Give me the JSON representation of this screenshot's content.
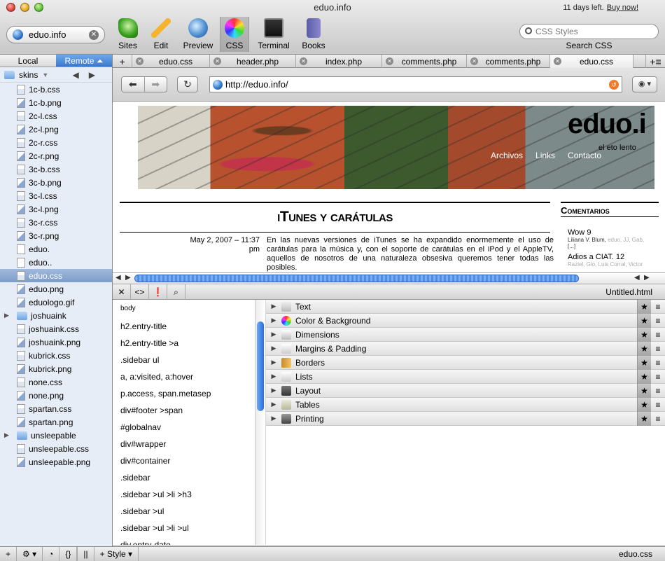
{
  "window": {
    "title": "eduo.info",
    "trial_text": "11 days left.",
    "buy_link": "Buy now!"
  },
  "site_selector": {
    "value": "eduo.info"
  },
  "toolbar": {
    "sites": "Sites",
    "edit": "Edit",
    "preview": "Preview",
    "css": "CSS",
    "terminal": "Terminal",
    "books": "Books",
    "search_placeholder": "CSS Styles",
    "search_label": "Search CSS"
  },
  "sidebar": {
    "local_tab": "Local",
    "remote_tab": "Remote",
    "current_folder": "skins",
    "files": [
      {
        "name": "1c-b.css",
        "kind": "css"
      },
      {
        "name": "1c-b.png",
        "kind": "img"
      },
      {
        "name": "2c-l.css",
        "kind": "css"
      },
      {
        "name": "2c-l.png",
        "kind": "img"
      },
      {
        "name": "2c-r.css",
        "kind": "css"
      },
      {
        "name": "2c-r.png",
        "kind": "img"
      },
      {
        "name": "3c-b.css",
        "kind": "css"
      },
      {
        "name": "3c-b.png",
        "kind": "img"
      },
      {
        "name": "3c-l.css",
        "kind": "css"
      },
      {
        "name": "3c-l.png",
        "kind": "img"
      },
      {
        "name": "3c-r.css",
        "kind": "css"
      },
      {
        "name": "3c-r.png",
        "kind": "img"
      },
      {
        "name": "eduo.",
        "kind": "plain"
      },
      {
        "name": "eduo..",
        "kind": "plain"
      },
      {
        "name": "eduo.css",
        "kind": "css",
        "selected": true
      },
      {
        "name": "eduo.png",
        "kind": "img"
      },
      {
        "name": "eduologo.gif",
        "kind": "img"
      },
      {
        "name": "joshuaink",
        "kind": "folder"
      },
      {
        "name": "joshuaink.css",
        "kind": "css"
      },
      {
        "name": "joshuaink.png",
        "kind": "img"
      },
      {
        "name": "kubrick.css",
        "kind": "css"
      },
      {
        "name": "kubrick.png",
        "kind": "img"
      },
      {
        "name": "none.css",
        "kind": "css"
      },
      {
        "name": "none.png",
        "kind": "img"
      },
      {
        "name": "spartan.css",
        "kind": "css"
      },
      {
        "name": "spartan.png",
        "kind": "img"
      },
      {
        "name": "unsleepable",
        "kind": "folder"
      },
      {
        "name": "unsleepable.css",
        "kind": "css"
      },
      {
        "name": "unsleepable.png",
        "kind": "img"
      }
    ]
  },
  "tabs": [
    {
      "label": "eduo.css"
    },
    {
      "label": "header.php"
    },
    {
      "label": "index.php"
    },
    {
      "label": "comments.php"
    },
    {
      "label": "comments.php"
    },
    {
      "label": "eduo.css",
      "active": true
    }
  ],
  "address": {
    "url": "http://eduo.info/"
  },
  "webpage": {
    "brand": "eduo.i",
    "brand_sub": "el eto lento",
    "nav": [
      "Archivos",
      "Links",
      "Contacto"
    ],
    "entry_title": "iTunes y carátulas",
    "entry_date": "May 2, 2007 – 11:37 pm",
    "entry_body": "En las nuevas versiones de iTunes se ha expandido enormemente el uso de carátulas para la música y, con el soporte de carátulas en el iPod y el AppleTV, aquellos de nosotros de una naturaleza obsesiva queremos tener todas las posibles.",
    "sidebar_heading": "Comentarios",
    "comments": [
      {
        "title": "Wow",
        "count": "9",
        "meta": "Liliana V. Blum,",
        "meta_faded": "eduo, JJ, Gab,",
        "more": "[...]"
      },
      {
        "title": "Adios a CIAT.",
        "count": "12",
        "meta": "",
        "meta_faded": "Raziel, Glo, Luis Corral, Victor",
        "more": ""
      }
    ]
  },
  "inspector": {
    "document_name": "Untitled.html",
    "selectors": [
      "body",
      "h2.entry-title",
      "h2.entry-title >a",
      ".sidebar ul",
      "a, a:visited, a:hover",
      "p.access, span.metasep",
      "div#footer >span",
      "#globalnav",
      "div#wrapper",
      "div#container",
      ".sidebar",
      ".sidebar >ul >li >h3",
      ".sidebar >ul",
      ".sidebar >ul >li >ul",
      "div.entry-date"
    ],
    "property_groups": [
      {
        "label": "Text",
        "icon": "text-icon"
      },
      {
        "label": "Color & Background",
        "icon": "color-wheel-icon"
      },
      {
        "label": "Dimensions",
        "icon": "dimensions-icon"
      },
      {
        "label": "Margins & Padding",
        "icon": "margins-icon"
      },
      {
        "label": "Borders",
        "icon": "borders-icon"
      },
      {
        "label": "Lists",
        "icon": "lists-icon"
      },
      {
        "label": "Layout",
        "icon": "pin-icon"
      },
      {
        "label": "Tables",
        "icon": "tables-icon"
      },
      {
        "label": "Printing",
        "icon": "printer-icon"
      }
    ]
  },
  "statusbar": {
    "style_button": "Style",
    "file_name": "eduo.css"
  }
}
